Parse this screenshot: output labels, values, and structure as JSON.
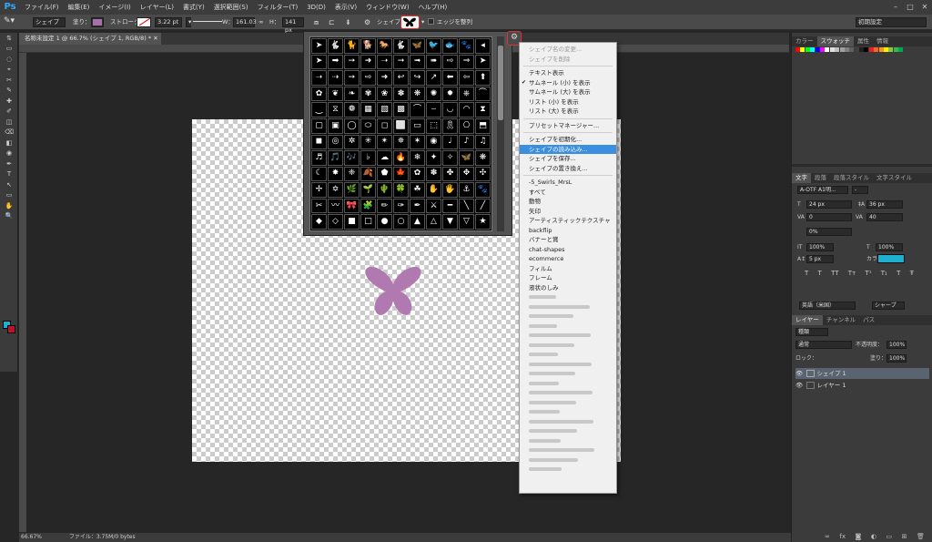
{
  "app": {
    "logo": "Ps"
  },
  "menubar": {
    "items": [
      "ファイル(F)",
      "編集(E)",
      "イメージ(I)",
      "レイヤー(L)",
      "書式(Y)",
      "選択範囲(S)",
      "フィルター(T)",
      "3D(D)",
      "表示(V)",
      "ウィンドウ(W)",
      "ヘルプ(H)"
    ]
  },
  "options": {
    "mode": "シェイプ",
    "fill_label": "塗り：",
    "fill_color": "#a870a8",
    "stroke_label": "ストローク：",
    "stroke_width": "3.22 pt",
    "w_label": "W：",
    "w_value": "161.03",
    "h_label": "H：",
    "h_value": "141 px",
    "shape_label": "シェイプ：",
    "align_edges": "エッジを整列",
    "workspace": "初期設定"
  },
  "document": {
    "tab": "名称未設定 1 @ 66.7% (シェイプ 1, RGB/8) *"
  },
  "shape_menu": {
    "items": [
      {
        "label": "シェイプ名の変更...",
        "state": "disabled"
      },
      {
        "label": "シェイプを削除",
        "state": "disabled"
      },
      {
        "sep": true
      },
      {
        "label": "テキスト表示"
      },
      {
        "label": "サムネール (小) を表示",
        "checked": true
      },
      {
        "label": "サムネール (大) を表示"
      },
      {
        "label": "リスト (小) を表示"
      },
      {
        "label": "リスト (大) を表示"
      },
      {
        "sep": true
      },
      {
        "label": "プリセットマネージャー..."
      },
      {
        "sep": true
      },
      {
        "label": "シェイプを初期化..."
      },
      {
        "label": "シェイプの読み込み...",
        "state": "highlighted"
      },
      {
        "label": "シェイプを保存..."
      },
      {
        "label": "シェイプの置き換え..."
      },
      {
        "sep": true
      },
      {
        "label": "-5_Swirls_MrsL"
      },
      {
        "label": "すべて"
      },
      {
        "label": "動物"
      },
      {
        "label": "矢印"
      },
      {
        "label": "アーティスティックテクスチャ"
      },
      {
        "label": "backflip"
      },
      {
        "label": "バナーと賞"
      },
      {
        "label": "chat-shapes"
      },
      {
        "label": "ecommerce"
      },
      {
        "label": "フィルム"
      },
      {
        "label": "フレーム"
      },
      {
        "label": "液状のしみ"
      }
    ],
    "blurred_count": 19
  },
  "panels": {
    "top_tabs": [
      "カラー",
      "スウォッチ",
      "属性",
      "情報"
    ],
    "swatch_colors": [
      "#ff0000",
      "#ffff00",
      "#00ff00",
      "#00ffff",
      "#0000ff",
      "#ff00ff",
      "#ffffff",
      "#e0e0e0",
      "#c0c0c0",
      "#a0a0a0",
      "#808080",
      "#606060",
      "#404040",
      "#202020",
      "#000000",
      "#ee1d24",
      "#f26522",
      "#f7941d",
      "#fff200",
      "#8dc63f",
      "#39b54a",
      "#00a651"
    ],
    "char_tabs": [
      "文字",
      "段落",
      "段落スタイル",
      "文字スタイル"
    ],
    "font_family": "A-OTF A1明...",
    "font_size": "24 px",
    "leading": "36 px",
    "kerning": "0",
    "tracking": "40",
    "scale_pct": "0%",
    "v_scale": "100%",
    "h_scale": "100%",
    "baseline": "5 px",
    "color_label": "カラー：",
    "text_color": "#1fb0cf",
    "lang": "英語（米国）",
    "aa": "シャープ",
    "layers_tabs": [
      "レイヤー",
      "チャンネル",
      "パス"
    ],
    "kind": "種類",
    "blend": "通常",
    "opacity_label": "不透明度：",
    "opacity": "100%",
    "lock_label": "ロック：",
    "fill_label": "塗り：",
    "fill_value": "100%",
    "layers": [
      "シェイプ 1",
      "レイヤー 1"
    ]
  },
  "status": {
    "zoom": "66.67%",
    "file": "ファイル：3.75M/0 bytes"
  }
}
